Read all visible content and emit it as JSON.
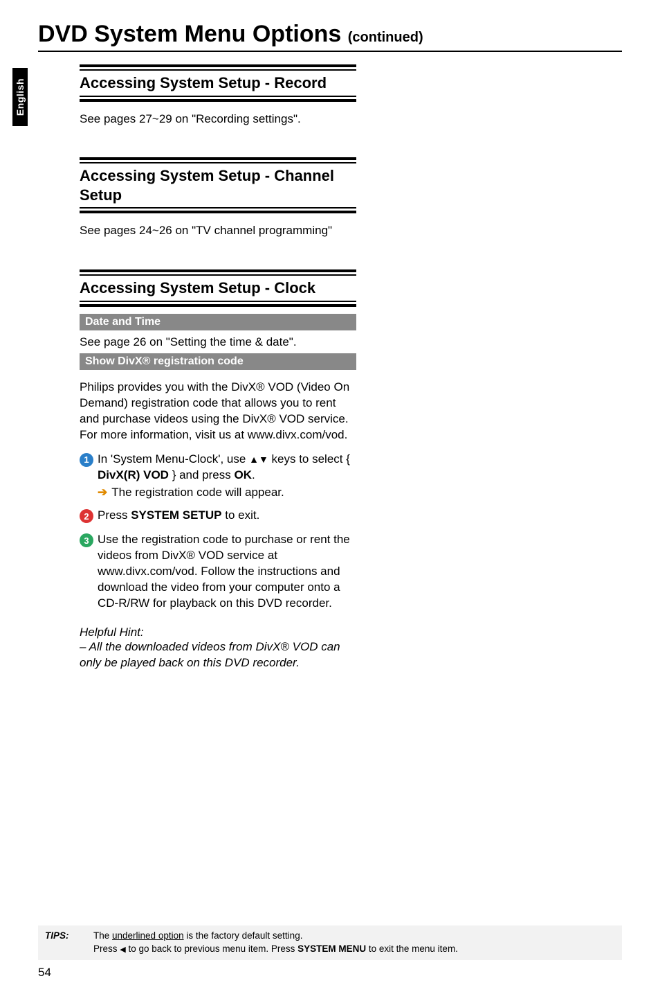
{
  "title": {
    "main": "DVD System Menu Options ",
    "cont": "(continued)"
  },
  "sidetab": "English",
  "sections": {
    "record": {
      "heading": "Accessing System Setup - Record",
      "body": "See pages 27~29 on \"Recording settings\"."
    },
    "channel": {
      "heading": "Accessing System Setup - Channel Setup",
      "body": "See pages 24~26 on \"TV channel programming\""
    },
    "clock": {
      "heading": "Accessing System Setup - Clock",
      "band1": "Date and Time",
      "body1": "See page 26 on \"Setting the time & date\".",
      "band2": "Show DivX® registration code",
      "para": "Philips provides you with the DivX® VOD (Video On Demand) registration code that allows you to rent and purchase videos using the DivX® VOD service. For more information, visit us at www.divx.com/vod.",
      "step1_a": "In 'System Menu-Clock', use ",
      "step1_b": " keys to select { ",
      "step1_bold": "DivX(R)  VOD",
      "step1_c": " } and press ",
      "step1_ok": "OK",
      "step1_d": ".",
      "step1_sub": "The registration code will appear.",
      "step2_a": "Press ",
      "step2_bold": "SYSTEM SETUP",
      "step2_b": " to exit.",
      "step3": "Use the registration code to purchase or rent the videos from DivX® VOD service at www.divx.com/vod. Follow the instructions and download the video from your computer onto a CD-R/RW for playback on this DVD recorder.",
      "hint_head": "Helpful Hint:",
      "hint_body": "– All the downloaded videos from DivX® VOD can only be played back on this DVD recorder."
    }
  },
  "tips": {
    "label": "TIPS:",
    "line1_a": "The ",
    "line1_u": "underlined option",
    "line1_b": " is the factory default setting.",
    "line2_a": "Press ",
    "line2_b": " to go back to previous menu item. Press ",
    "line2_bold": "SYSTEM MENU",
    "line2_c": " to exit the menu item."
  },
  "pagenum": "54"
}
